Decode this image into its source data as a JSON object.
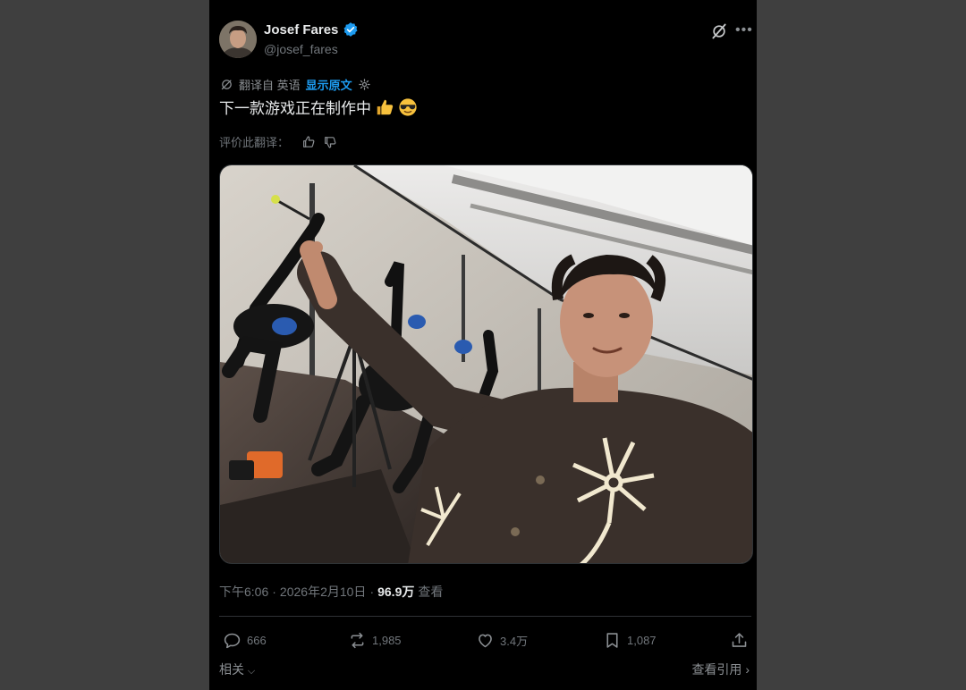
{
  "post": {
    "author": {
      "name": "Josef Fares",
      "handle": "@josef_fares",
      "verified": true
    },
    "translation": {
      "label": "翻译自 英语",
      "show_original": "显示原文"
    },
    "text": "下一款游戏正在制作中",
    "emojis": [
      "thumbs-up",
      "smiling-face-with-sunglasses"
    ],
    "rate_translation": "评价此翻译：",
    "meta": {
      "time": "下午6:06",
      "sep1": "·",
      "date": "2026年2月10日",
      "sep2": "·",
      "views": "96.9万",
      "views_label": "查看"
    },
    "actions": {
      "replies": "666",
      "reposts": "1,985",
      "likes": "3.4万",
      "bookmarks": "1,087"
    },
    "related": "相关",
    "view_quotes": "查看引用"
  },
  "colors": {
    "accent": "#1d9bf0",
    "muted": "#71767b",
    "background": "#000000",
    "page_bg": "#3f3f3f"
  }
}
